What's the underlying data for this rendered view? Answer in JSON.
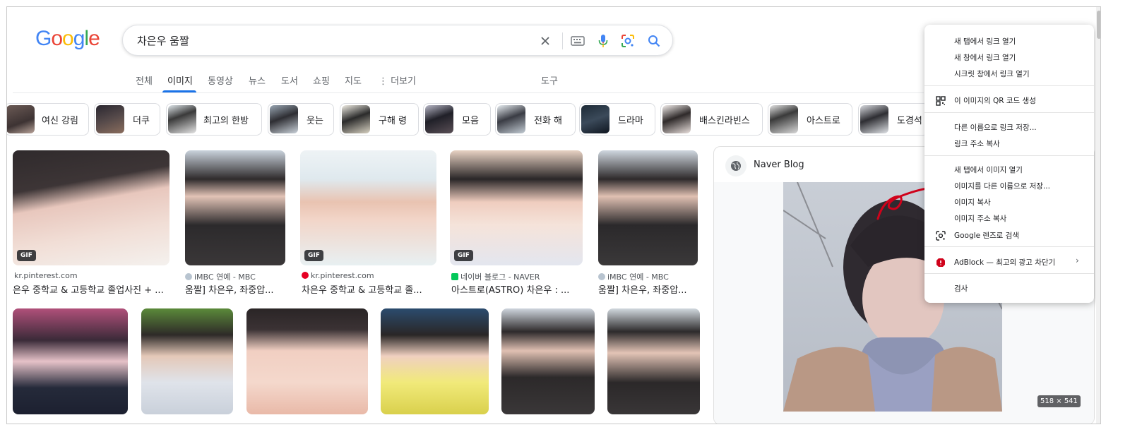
{
  "logo": {
    "text": "Google",
    "letters": [
      "G",
      "o",
      "o",
      "g",
      "l",
      "e"
    ]
  },
  "search": {
    "query": "차은우 움짤"
  },
  "tabs": [
    "전체",
    "이미지",
    "동영상",
    "뉴스",
    "도서",
    "쇼핑",
    "지도",
    "⋮ 더보기"
  ],
  "tools_label": "도구",
  "chips": [
    "여신 강림",
    "더쿠",
    "최고의 한방",
    "웃는",
    "구해 령",
    "모음",
    "전화 해",
    "드라마",
    "배스킨라빈스",
    "아스트로",
    "도경석"
  ],
  "gif_badge": "GIF",
  "results": [
    {
      "source": "kr.pinterest.com",
      "title": "은우 중학교 & 고등학교 졸업사진 + ..."
    },
    {
      "source": "iMBC 연예 - MBC",
      "title": "움짤] 차은우, 좌중압..."
    },
    {
      "source": "kr.pinterest.com",
      "title": "차은우 중학교 & 고등학교 졸..."
    },
    {
      "source": "네이버 블로그 - NAVER",
      "title": "아스트로(ASTRO) 차은우 : ..."
    },
    {
      "source": "iMBC 연예 - MBC",
      "title": "움짤] 차은우, 좌중압..."
    }
  ],
  "panel": {
    "source": "Naver Blog",
    "dims": "518 × 541"
  },
  "context_menu": {
    "items": [
      "새 탭에서 링크 열기",
      "새 창에서 링크 열기",
      "시크릿 창에서 링크 열기",
      "이 이미지의 QR 코드 생성",
      "다른 이름으로 링크 저장...",
      "링크 주소 복사",
      "새 탭에서 이미지 열기",
      "이미지를 다른 이름으로 저장...",
      "이미지 복사",
      "이미지 주소 복사",
      "Google 렌즈로 검색",
      "AdBlock — 최고의 광고 차단기",
      "검사"
    ]
  },
  "colors": {
    "accent": "#1a73e8",
    "annotation": "#d0021b"
  }
}
